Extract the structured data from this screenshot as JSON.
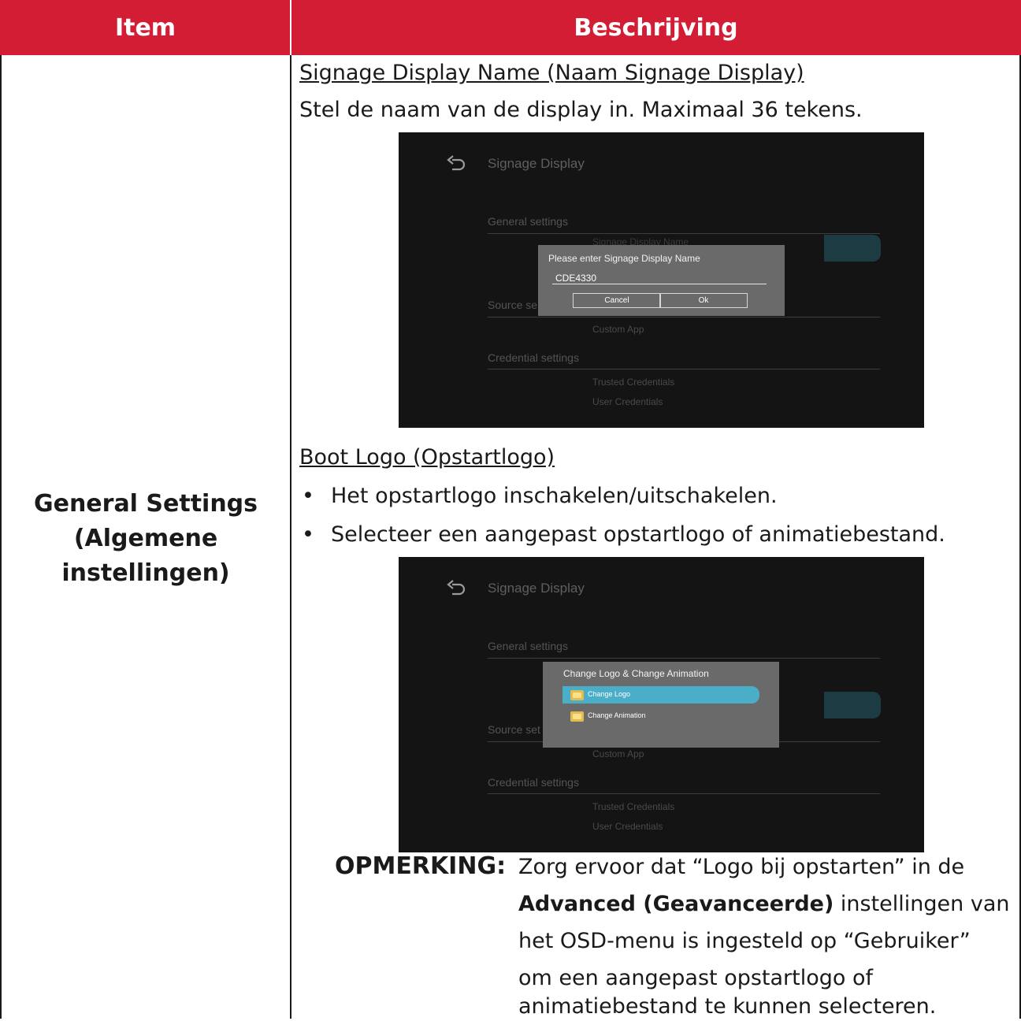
{
  "table": {
    "header": {
      "col_item": "Item",
      "col_desc": "Beschrijving"
    },
    "row": {
      "item_lines": [
        "General Settings",
        "(Algemene",
        "instellingen)"
      ]
    }
  },
  "section1": {
    "heading": "Signage Display Name (Naam Signage Display)",
    "text": "Stel de naam van de display in. Maximaal 36 tekens."
  },
  "screenshot1": {
    "title": "Signage Display",
    "general_settings": "General settings",
    "hidden_item": "Signage Display Name",
    "source_partial": "Source se",
    "custom_app": "Custom App",
    "credential_settings": "Credential settings",
    "trusted_credentials": "Trusted Credentials",
    "user_credentials": "User Credentials",
    "dialog": {
      "title": "Please enter Signage Display Name",
      "value": "CDE4330",
      "cancel_label": "Cancel",
      "ok_label": "Ok"
    }
  },
  "section2": {
    "heading": "Boot Logo (Opstartlogo)",
    "bullets": [
      "Het opstartlogo inschakelen/uitschakelen.",
      "Selecteer een aangepast opstartlogo of animatiebestand."
    ]
  },
  "screenshot2": {
    "title": "Signage Display",
    "general_settings": "General settings",
    "source_partial": "Source set",
    "custom_app": "Custom App",
    "credential_settings": "Credential settings",
    "trusted_credentials": "Trusted Credentials",
    "user_credentials": "User Credentials",
    "dialog": {
      "title": "Change Logo & Change Animation",
      "options": [
        "Change Logo",
        "Change Animation"
      ]
    }
  },
  "note": {
    "label": "OPMERKING:",
    "line1": "Zorg ervoor dat “Logo bij opstarten” in de",
    "line2_bold": "Advanced (Geavanceerde)",
    "line2_rest": " instellingen van",
    "line3": "het OSD-menu is ingesteld op “Gebruiker”",
    "line4": "om een aangepast opstartlogo of",
    "line5": "animatiebestand te kunnen selecteren."
  },
  "colors": {
    "header_bg": "#d31d34",
    "header_text": "#ffffff",
    "highlight": "#4aaec9"
  },
  "icons": [
    "back-arrow-icon",
    "folder-icon",
    "bullet-icon"
  ]
}
